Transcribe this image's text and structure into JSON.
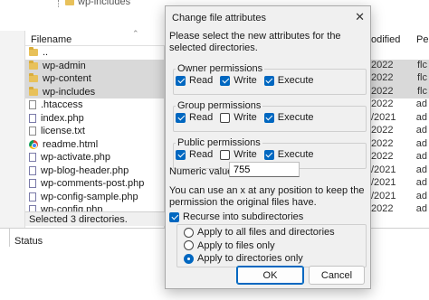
{
  "background": {
    "tree_item": "wp-includes",
    "file_header": {
      "filename": "Filename"
    },
    "right_headers": {
      "modified": "odified",
      "perms": "Pe"
    },
    "files": [
      {
        "name": "..",
        "icon": "folder-icon",
        "selected": false
      },
      {
        "name": "wp-admin",
        "icon": "folder-icon",
        "selected": true
      },
      {
        "name": "wp-content",
        "icon": "folder-icon",
        "selected": true
      },
      {
        "name": "wp-includes",
        "icon": "folder-icon",
        "selected": true
      },
      {
        "name": ".htaccess",
        "icon": "file-icon",
        "selected": false
      },
      {
        "name": "index.php",
        "icon": "php-icon",
        "selected": false
      },
      {
        "name": "license.txt",
        "icon": "file-icon",
        "selected": false
      },
      {
        "name": "readme.html",
        "icon": "chrome-icon",
        "selected": false
      },
      {
        "name": "wp-activate.php",
        "icon": "php-icon",
        "selected": false
      },
      {
        "name": "wp-blog-header.php",
        "icon": "php-icon",
        "selected": false
      },
      {
        "name": "wp-comments-post.php",
        "icon": "php-icon",
        "selected": false
      },
      {
        "name": "wp-config-sample.php",
        "icon": "php-icon",
        "selected": false
      },
      {
        "name": "wp-config.php",
        "icon": "php-icon",
        "selected": false
      }
    ],
    "right_rows": [
      {
        "date": "",
        "perm": ""
      },
      {
        "date": "2022 ",
        "perm": "flc"
      },
      {
        "date": "2022 ",
        "perm": "flc"
      },
      {
        "date": "2022 ",
        "perm": "flc"
      },
      {
        "date": "2022 ",
        "perm": "ad"
      },
      {
        "date": "/2021 ",
        "perm": "ad"
      },
      {
        "date": "2022 ",
        "perm": "ad"
      },
      {
        "date": "2022 ",
        "perm": "ad"
      },
      {
        "date": "2022 ",
        "perm": "ad"
      },
      {
        "date": "/2021 ",
        "perm": "ad"
      },
      {
        "date": "/2021 ",
        "perm": "ad"
      },
      {
        "date": "/2021 ",
        "perm": "ad"
      },
      {
        "date": "2022 ",
        "perm": "ad"
      }
    ],
    "selection_status": "Selected 3 directories.",
    "bottom_status": "Status"
  },
  "dialog": {
    "title": "Change file attributes",
    "close_glyph": "✕",
    "intro": "Please select the new attributes for the selected directories.",
    "groups": [
      {
        "label": "Owner permissions",
        "items": [
          {
            "label": "Read",
            "checked": true
          },
          {
            "label": "Write",
            "checked": true
          },
          {
            "label": "Execute",
            "checked": true
          }
        ]
      },
      {
        "label": "Group permissions",
        "items": [
          {
            "label": "Read",
            "checked": true
          },
          {
            "label": "Write",
            "checked": false
          },
          {
            "label": "Execute",
            "checked": true
          }
        ]
      },
      {
        "label": "Public permissions",
        "items": [
          {
            "label": "Read",
            "checked": true
          },
          {
            "label": "Write",
            "checked": false
          },
          {
            "label": "Execute",
            "checked": true
          }
        ]
      }
    ],
    "numeric_label": "Numeric value:",
    "numeric_value": "755",
    "hint": "You can use an x at any position to keep the permission the original files have.",
    "recurse_label": "Recurse into subdirectories",
    "recurse_checked": true,
    "radio_options": [
      {
        "label": "Apply to all files and directories",
        "selected": false
      },
      {
        "label": "Apply to files only",
        "selected": false
      },
      {
        "label": "Apply to directories only",
        "selected": true
      }
    ],
    "ok_label": "OK",
    "cancel_label": "Cancel"
  },
  "colors": {
    "accent": "#0067c0",
    "selection_bg": "#d9d9d9",
    "folder": "#e8c15a"
  }
}
